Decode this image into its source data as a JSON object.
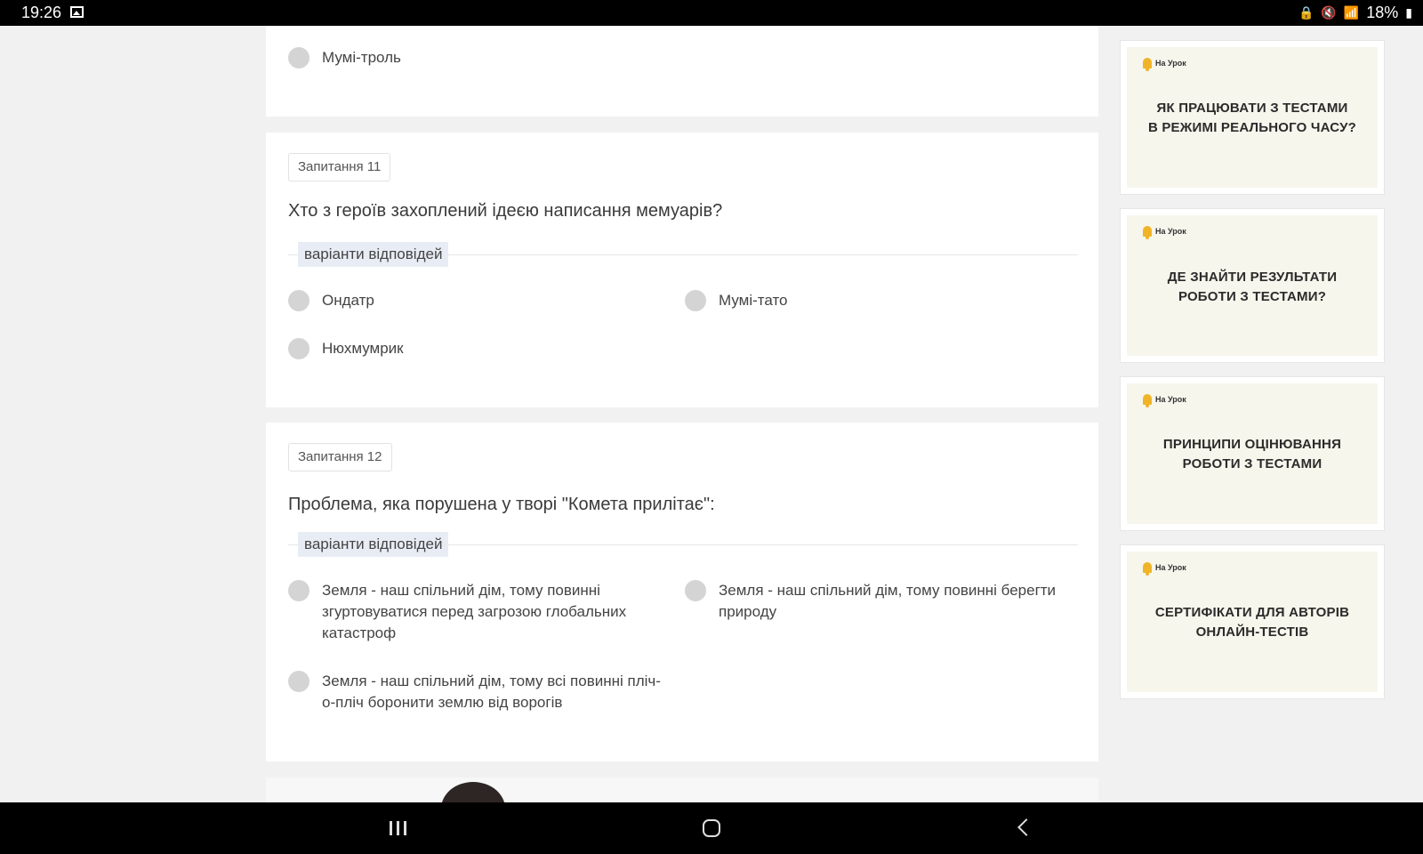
{
  "status_bar": {
    "time": "19:26",
    "battery": "18%",
    "icons": [
      "gallery-icon",
      "lock-icon",
      "mute-icon",
      "wifi-icon",
      "signal-icon",
      "battery-icon"
    ]
  },
  "prev_question": {
    "option": "Мумі-троль"
  },
  "q11": {
    "badge": "Запитання 11",
    "text": "Хто з героїв захоплений ідеєю написання мемуарів?",
    "answers_label": "варіанти відповідей",
    "options": [
      "Ондатр",
      "Мумі-тато",
      "Нюхмумрик"
    ]
  },
  "q12": {
    "badge": "Запитання 12",
    "text": "Проблема, яка порушена у творі \"Комета прилітає\":",
    "answers_label": "варіанти відповідей",
    "options": [
      "Земля - наш спільний дім, тому повинні згуртовуватися перед загрозою глобальних катастроф",
      "Земля - наш спільний дім, тому повинні берегти природу",
      "Земля - наш спільний дім, тому всі повинні пліч-о-пліч боронити землю від ворогів"
    ]
  },
  "sidebar": {
    "brand": "На Урок",
    "promos": [
      {
        "line1": "ЯК ПРАЦЮВАТИ З ТЕСТАМИ",
        "line2": "В РЕЖИМІ РЕАЛЬНОГО ЧАСУ?"
      },
      {
        "line1": "ДЕ ЗНАЙТИ РЕЗУЛЬТАТИ",
        "line2": "РОБОТИ З ТЕСТАМИ?"
      },
      {
        "line1": "ПРИНЦИПИ ОЦІНЮВАННЯ",
        "line2": "РОБОТИ З ТЕСТАМИ"
      },
      {
        "line1": "СЕРТИФІКАТИ ДЛЯ АВТОРІВ",
        "line2": "ОНЛАЙН-ТЕСТІВ"
      }
    ]
  },
  "colors": {
    "page_bg": "#f1f1f1",
    "radio": "#d4d4d4",
    "answers_label_bg": "#e8ecf4",
    "promo_bg": "#f7f6ec",
    "brand_bell": "#f0b428"
  }
}
